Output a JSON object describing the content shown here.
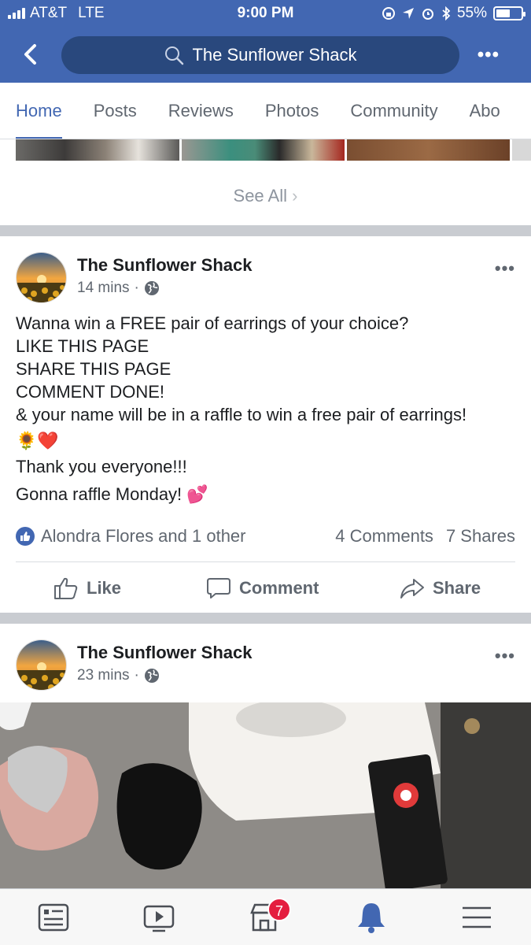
{
  "status_bar": {
    "carrier": "AT&T",
    "network": "LTE",
    "time": "9:00 PM",
    "battery_percent": "55%",
    "battery_level": 0.55
  },
  "nav": {
    "search_text": "The Sunflower Shack",
    "back_icon": "chevron-left-icon",
    "more_icon": "ellipsis-icon"
  },
  "tabs": [
    {
      "label": "Home",
      "active": true
    },
    {
      "label": "Posts"
    },
    {
      "label": "Reviews"
    },
    {
      "label": "Photos"
    },
    {
      "label": "Community"
    },
    {
      "label": "Abo"
    }
  ],
  "photos_section": {
    "see_all": "See All"
  },
  "post1": {
    "page_name": "The Sunflower Shack",
    "time": "14 mins",
    "lines": [
      "Wanna win a FREE pair of earrings of your choice?",
      "LIKE THIS PAGE",
      "SHARE THIS PAGE",
      "COMMENT DONE!",
      "& your name will be in a raffle to win a free pair of earrings!",
      "🌻❤️",
      "Thank you everyone!!!",
      "Gonna raffle Monday! 💕"
    ],
    "reactions_text": "Alondra Flores and 1 other",
    "comments_text": "4 Comments",
    "shares_text": "7 Shares",
    "actions": {
      "like": "Like",
      "comment": "Comment",
      "share": "Share"
    }
  },
  "post2": {
    "page_name": "The Sunflower Shack",
    "time": "23 mins"
  },
  "bottom_nav": {
    "items": [
      "news-feed-icon",
      "watch-icon",
      "marketplace-icon",
      "notifications-icon",
      "menu-icon"
    ],
    "marketplace_badge": "7",
    "active": "notifications-icon"
  },
  "colors": {
    "brand": "#4267b2",
    "brand_dark": "#29487d",
    "badge": "#e41e3f",
    "muted": "#606770"
  }
}
